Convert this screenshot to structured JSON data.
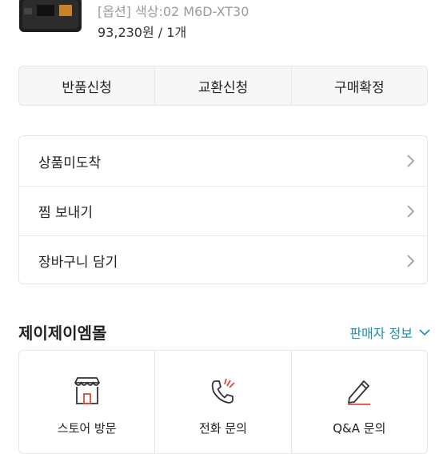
{
  "product": {
    "option": "[옵션] 색상:02 M6D-XT30",
    "price": "93,230원 / 1개"
  },
  "actions": [
    {
      "label": "반품신청"
    },
    {
      "label": "교환신청"
    },
    {
      "label": "구매확정"
    }
  ],
  "menu": [
    {
      "label": "상품미도착"
    },
    {
      "label": "찜 보내기"
    },
    {
      "label": "장바구니 담기"
    }
  ],
  "shop": {
    "name": "제이제이엠몰",
    "seller_info_label": "판매자 정보"
  },
  "contacts": [
    {
      "label": "스토어 방문",
      "icon": "store-icon"
    },
    {
      "label": "전화 문의",
      "icon": "phone-icon"
    },
    {
      "label": "Q&A 문의",
      "icon": "pencil-icon"
    }
  ],
  "colors": {
    "accent": "#1a8fb0",
    "icon_red": "#e0483a"
  }
}
